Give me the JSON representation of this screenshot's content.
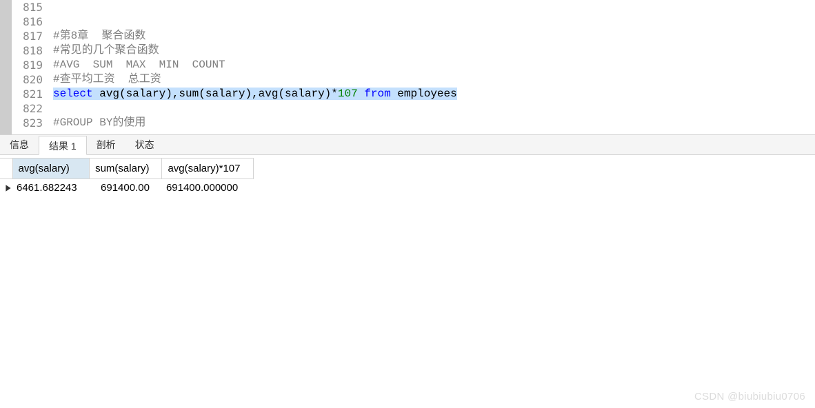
{
  "editor": {
    "lines": [
      {
        "num": "815",
        "tokens": []
      },
      {
        "num": "816",
        "tokens": []
      },
      {
        "num": "817",
        "tokens": [
          {
            "cls": "comment",
            "text": "#第8章  聚合函数"
          }
        ]
      },
      {
        "num": "818",
        "tokens": [
          {
            "cls": "comment",
            "text": "#常见的几个聚合函数"
          }
        ]
      },
      {
        "num": "819",
        "tokens": [
          {
            "cls": "comment",
            "text": "#AVG  SUM  MAX  MIN  COUNT"
          }
        ]
      },
      {
        "num": "820",
        "tokens": [
          {
            "cls": "comment",
            "text": "#查平均工资  总工资"
          }
        ]
      },
      {
        "num": "821",
        "highlighted": true,
        "tokens": [
          {
            "cls": "keyword",
            "text": "select"
          },
          {
            "cls": "plain",
            "text": " avg(salary),sum(salary),avg(salary)*"
          },
          {
            "cls": "number",
            "text": "107"
          },
          {
            "cls": "plain",
            "text": " "
          },
          {
            "cls": "keyword",
            "text": "from"
          },
          {
            "cls": "plain",
            "text": " employees"
          }
        ]
      },
      {
        "num": "822",
        "tokens": []
      },
      {
        "num": "823",
        "tokens": [
          {
            "cls": "comment",
            "text": "#GROUP BY的使用"
          }
        ]
      }
    ]
  },
  "tabs": {
    "items": [
      {
        "label": "信息",
        "active": false
      },
      {
        "label": "结果 1",
        "active": true
      },
      {
        "label": "剖析",
        "active": false
      },
      {
        "label": "状态",
        "active": false
      }
    ]
  },
  "results": {
    "columns": [
      {
        "label": "avg(salary)",
        "align": "num-right",
        "selected": true
      },
      {
        "label": "sum(salary)",
        "align": "num-right",
        "selected": false
      },
      {
        "label": "avg(salary)*107",
        "align": "",
        "selected": false
      }
    ],
    "rows": [
      {
        "cells": [
          "6461.682243",
          "691400.00",
          "691400.000000"
        ]
      }
    ]
  },
  "watermark": "CSDN @biubiubiu0706"
}
